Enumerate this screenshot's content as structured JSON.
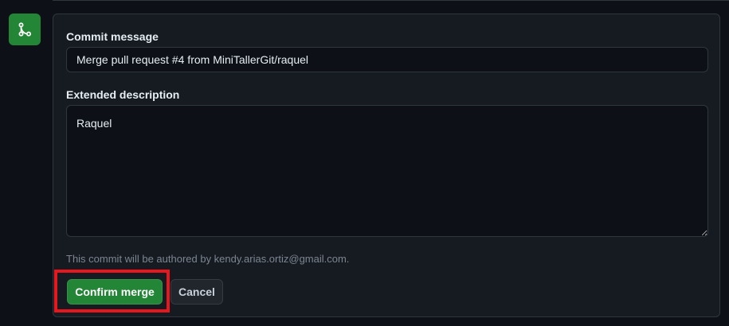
{
  "merge_form": {
    "commit_message_label": "Commit message",
    "commit_message_value": "Merge pull request #4 from MiniTallerGit/raquel",
    "extended_description_label": "Extended description",
    "extended_description_value": "Raquel",
    "author_note": "This commit will be authored by kendy.arias.ortiz@gmail.com.",
    "confirm_label": "Confirm merge",
    "cancel_label": "Cancel"
  },
  "icons": {
    "merge": "git-merge-icon"
  },
  "colors": {
    "page_background": "#0d1117",
    "panel_background": "#161b22",
    "border": "#30363d",
    "primary_button": "#238636",
    "highlight_annotation": "#e8161d",
    "text_primary": "#e6edf3",
    "text_muted": "#7d8590"
  }
}
